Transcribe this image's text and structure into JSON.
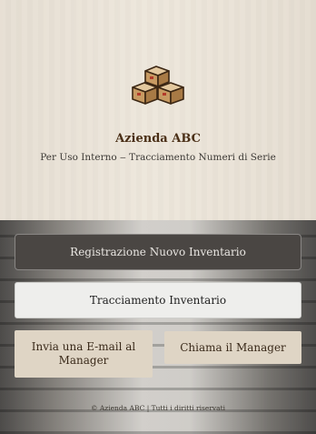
{
  "header": {
    "logo_icon": "stacked-boxes-icon",
    "title": "Azienda ABC",
    "subtitle": "Per Uso Interno ‒ Tracciamento Numeri di Serie"
  },
  "actions": {
    "register_inventory": "Registrazione Nuovo Inventario",
    "track_inventory": "Tracciamento Inventario",
    "email_manager": "Invia una E-mail al Manager",
    "call_manager": "Chiama il Manager"
  },
  "footer": {
    "text": "© Azienda ABC | Tutti i diritti riservati"
  },
  "colors": {
    "brand_text": "#4a2f16",
    "dark_button": "#4a4643",
    "light_button": "#eeeeec",
    "tan_button": "#dfd5c5"
  }
}
